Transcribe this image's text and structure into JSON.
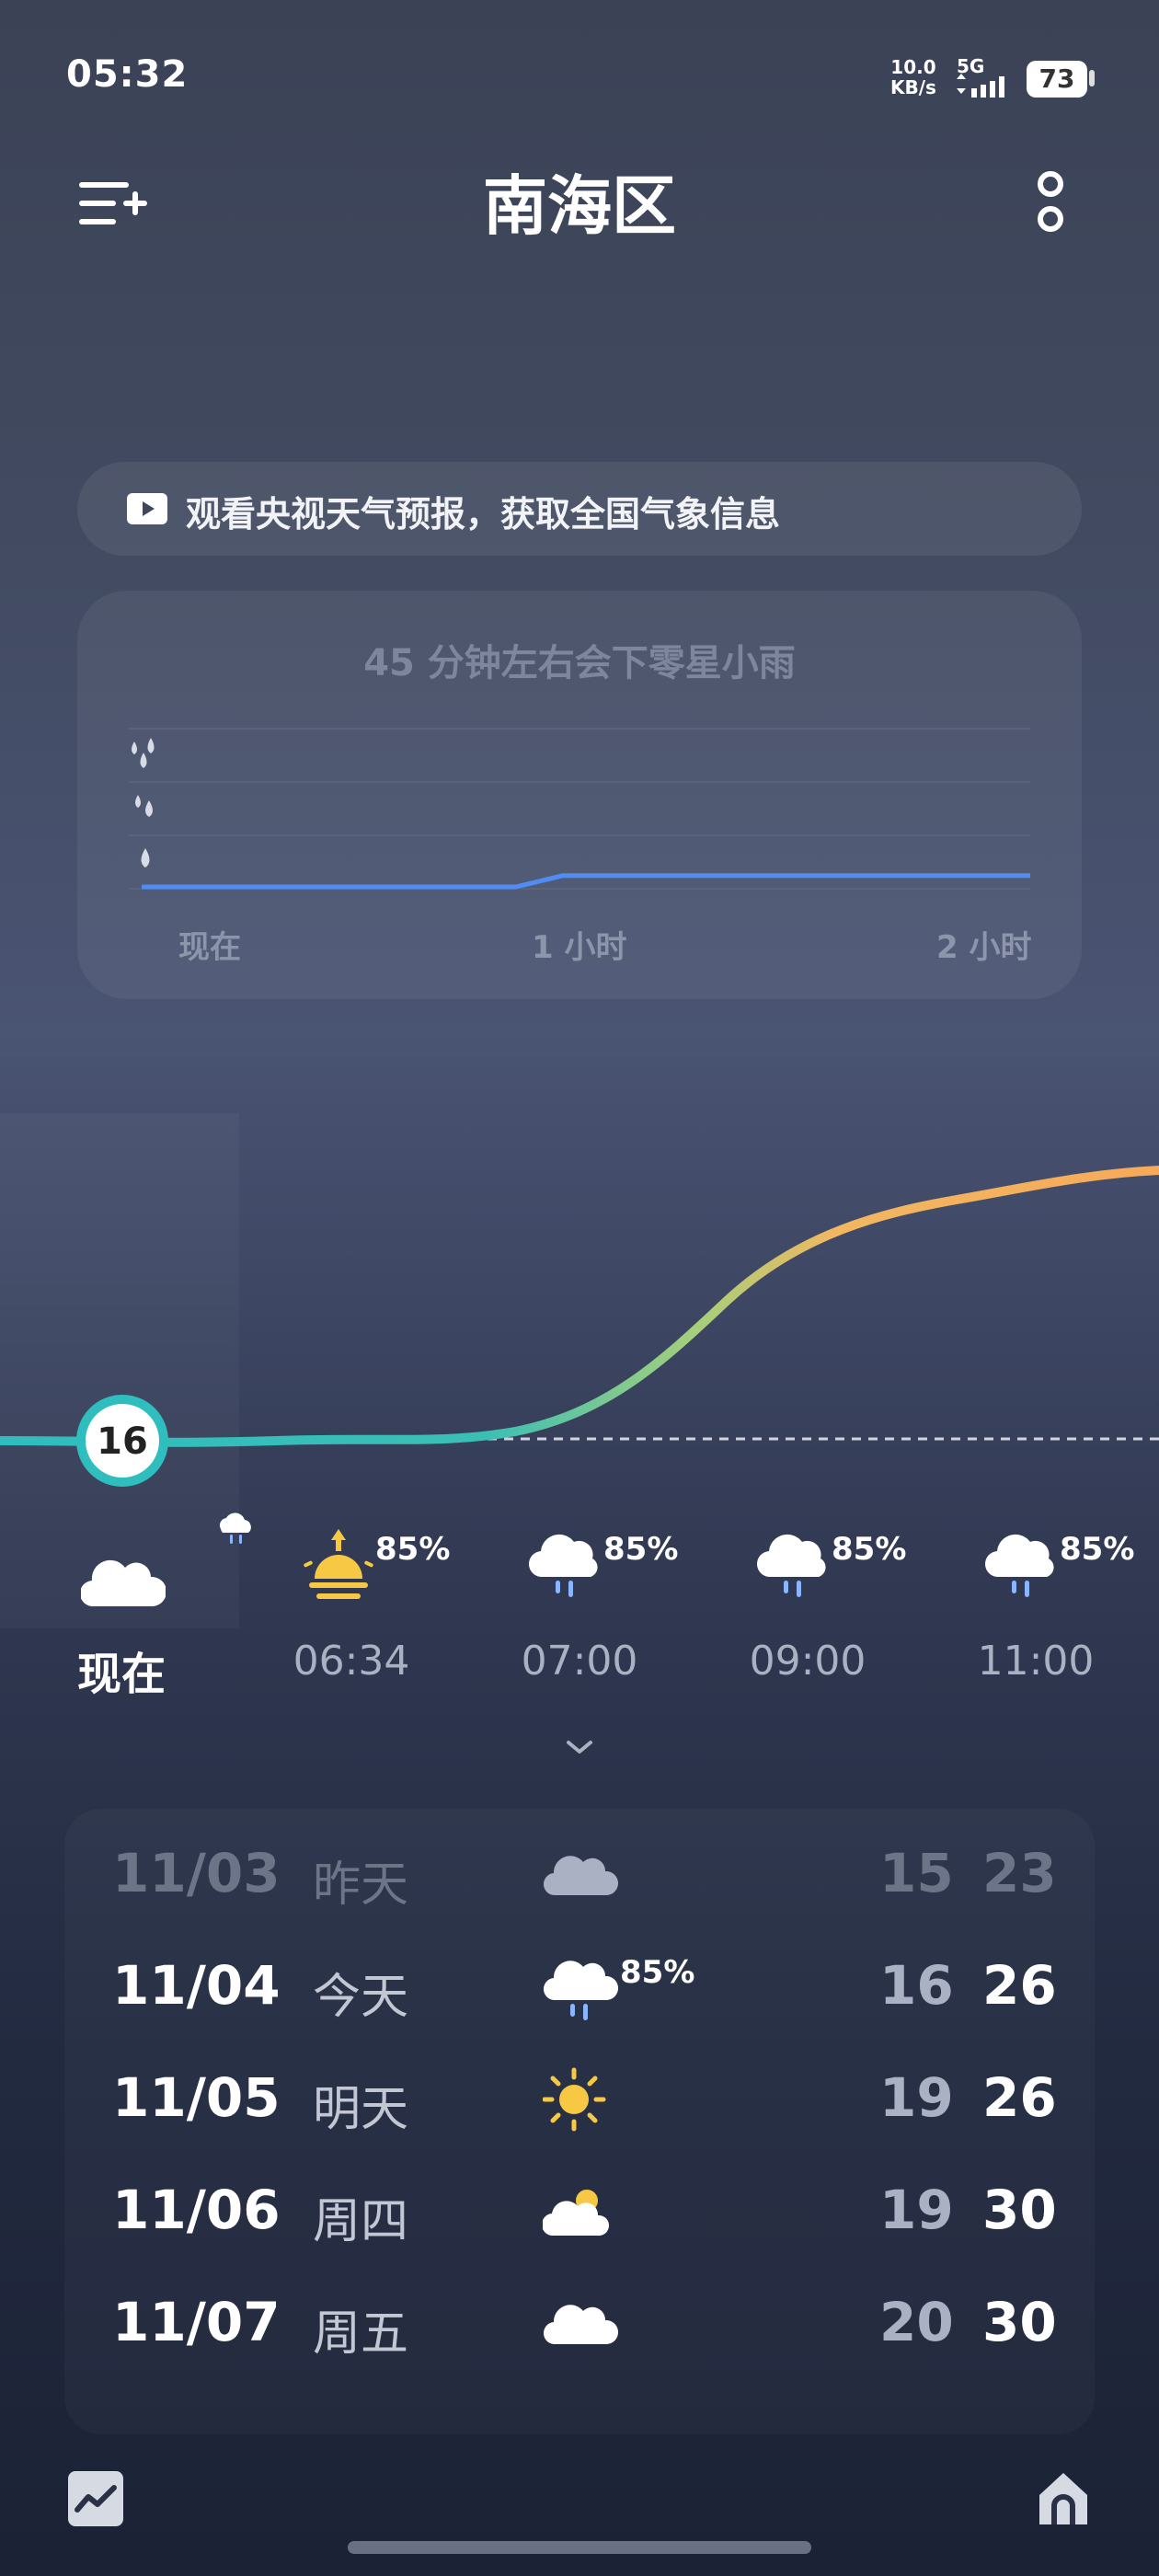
{
  "status_bar": {
    "time": "05:32",
    "net_speed_value": "10.0",
    "net_speed_unit": "KB/s",
    "network": "5G",
    "battery": "73"
  },
  "header": {
    "title": "南海区",
    "menu_icon": "menu-add-icon",
    "more_icon": "more-vertical-icon"
  },
  "banner": {
    "icon": "video-play-icon",
    "text": "观看央视天气预报，获取全国气象信息"
  },
  "rain_card": {
    "title": "45 分钟左右会下零星小雨",
    "x_labels": [
      "现在",
      "1 小时",
      "2 小时"
    ],
    "levels": [
      "heavy-rain-drops-icon",
      "moderate-rain-drops-icon",
      "light-rain-drop-icon"
    ],
    "rain_level_series": [
      0,
      0,
      0,
      0,
      0,
      0,
      0,
      0,
      0,
      0.07,
      0.07,
      0.07,
      0.07,
      0.07,
      0.07,
      0.07,
      0.07,
      0.07,
      0.07,
      0.07
    ]
  },
  "temperature": {
    "current": "16"
  },
  "hourly": [
    {
      "time": "现在",
      "icon": "cloudy-icon",
      "pct": ""
    },
    {
      "time": "06:34",
      "icon": "sunrise-icon",
      "pct": "85%"
    },
    {
      "time": "07:00",
      "icon": "rain-cloud-icon",
      "pct": "85%"
    },
    {
      "time": "09:00",
      "icon": "rain-cloud-icon",
      "pct": "85%"
    },
    {
      "time": "11:00",
      "icon": "rain-cloud-icon",
      "pct": "85%"
    }
  ],
  "daily": [
    {
      "date": "11/03",
      "name": "昨天",
      "icon": "cloudy-icon",
      "pct": "",
      "low": "15",
      "high": "23"
    },
    {
      "date": "11/04",
      "name": "今天",
      "icon": "rain-cloud-icon",
      "pct": "85%",
      "low": "16",
      "high": "26"
    },
    {
      "date": "11/05",
      "name": "明天",
      "icon": "sunny-icon",
      "pct": "",
      "low": "19",
      "high": "26"
    },
    {
      "date": "11/06",
      "name": "周四",
      "icon": "partly-cloudy-icon",
      "pct": "",
      "low": "19",
      "high": "30"
    },
    {
      "date": "11/07",
      "name": "周五",
      "icon": "cloudy-icon",
      "pct": "",
      "low": "20",
      "high": "30"
    }
  ],
  "bottom_nav": {
    "left_icon": "trend-chart-icon",
    "right_icon": "home-icon"
  },
  "colors": {
    "rain_line": "#4f8df5",
    "temp_start": "#2fbdbd",
    "temp_mid": "#a6cf7a",
    "temp_end": "#f6aa5a",
    "sun": "#f7c843"
  }
}
